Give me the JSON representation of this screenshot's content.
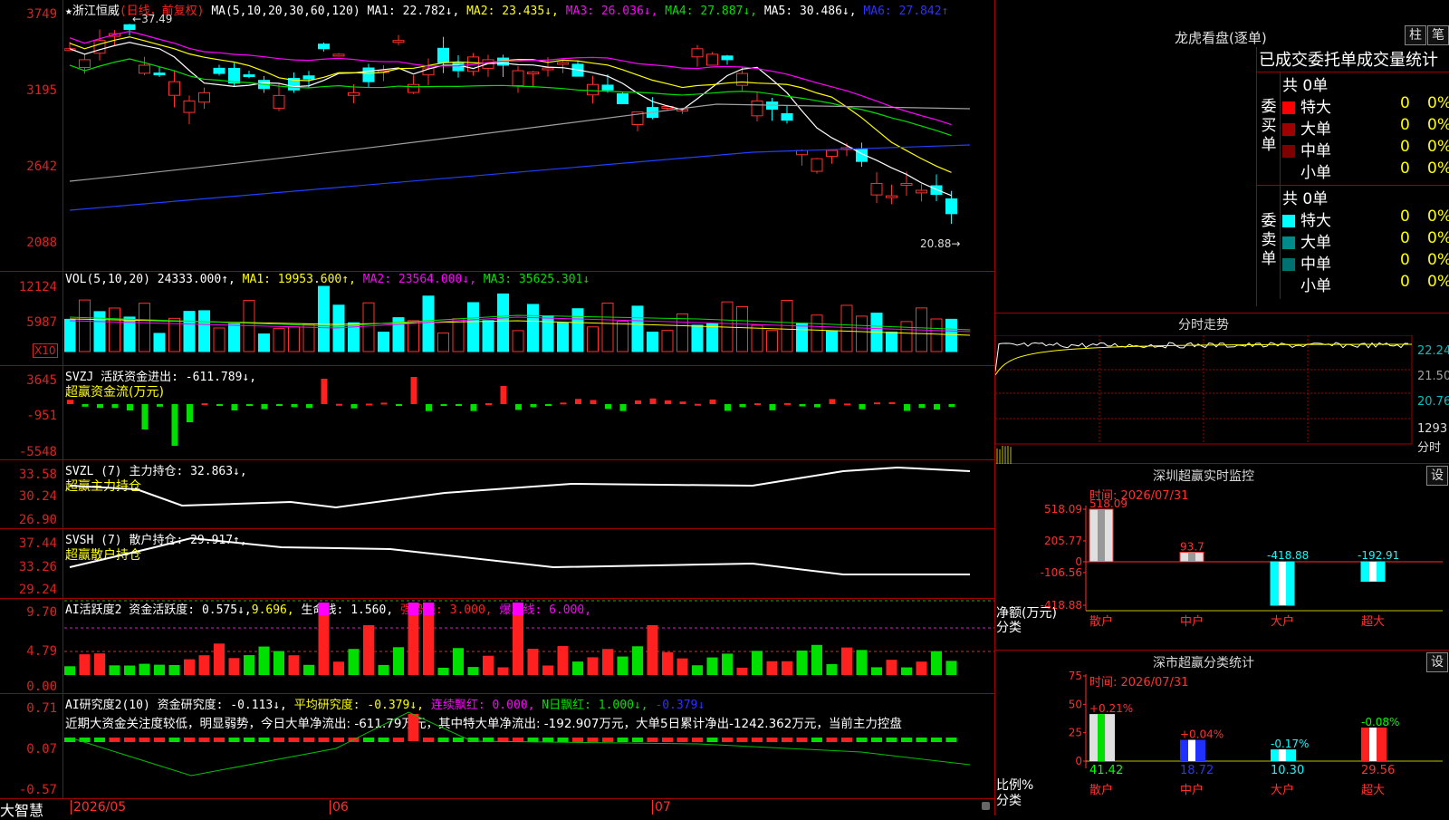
{
  "header": {
    "stock_name": "浙江恒威",
    "star": "★",
    "period": "(日线，前复权)",
    "ma_label": "MA(5,10,20,30,60,120)",
    "ma1": "MA1: 22.782↓,",
    "ma2": "MA2: 23.435↓,",
    "ma3": "MA3: 26.036↓,",
    "ma4": "MA4: 27.887↓,",
    "ma5": "MA5: 30.486↓,",
    "ma6": "MA6: 27.842↑",
    "max_label": "37.49",
    "min_label": "20.88",
    "price_ticks": [
      "3749",
      "3195",
      "2642",
      "2088"
    ]
  },
  "vol": {
    "label": "VOL(5,10,20)",
    "v": "24333.000↑,",
    "ma1": "MA1: 19953.600↑,",
    "ma2": "MA2: 23564.000↓,",
    "ma3": "MA3: 35625.301↓",
    "ticks": [
      "12124",
      "5987"
    ],
    "unit": "X10"
  },
  "svzj": {
    "label": "SVZJ  活跃资金进出: -611.789↓,",
    "sub": "超赢资金流(万元)",
    "ticks": [
      "3645",
      "-951",
      "-5548"
    ]
  },
  "svzl": {
    "label": "SVZL (7) 主力持仓: 32.863↓,",
    "sub": "超赢主力持仓",
    "ticks": [
      "33.58",
      "30.24",
      "26.90"
    ]
  },
  "svsh": {
    "label": "SVSH (7) 散户持仓: 29.917↑,",
    "sub": "超赢散户持仓",
    "ticks": [
      "37.44",
      "33.26",
      "29.24"
    ]
  },
  "ai1": {
    "a": "AI活跃度2 资金活跃度: 0.575↓,",
    "b": "9.696,",
    "c": "生命线: 1.560,",
    "d": "强势线: 3.000,",
    "e": "爆发线: 6.000,",
    "ticks": [
      "9.70",
      "4.79",
      "0.00"
    ]
  },
  "ai2": {
    "a": "AI研究度2(10) 资金研究度: -0.113↓,",
    "b": "平均研究度: -0.379↓,",
    "c": "连续飘红: 0.000,",
    "d": "N日飘红: 1.000↓,",
    "e": "-0.379↓",
    "note": "近期大资金关注度较低，明显弱势，今日大单净流出: -611.79万元，其中特大单净流出: -192.907万元，大单5日累计净出-1242.362万元，当前主力控盘",
    "ticks": [
      "0.71",
      "0.07",
      "-0.57"
    ]
  },
  "footer": {
    "brand": "大智慧",
    "dates": [
      "2026/05",
      "06",
      "07"
    ]
  },
  "lhb": {
    "title": "龙虎看盘(逐单)",
    "btn1": "柱",
    "btn2": "笔",
    "subtitle": "已成交委托单成交量统计",
    "buy_side": "委买单",
    "sell_side": "委卖单",
    "buy_total": "共 0单",
    "sell_total": "共 0单",
    "rows": [
      {
        "label": "特大",
        "count": "0",
        "pct": "0%"
      },
      {
        "label": "大单",
        "count": "0",
        "pct": "0%"
      },
      {
        "label": "中单",
        "count": "0",
        "pct": "0%"
      },
      {
        "label": "小单",
        "count": "0",
        "pct": "0%"
      }
    ],
    "buy_colors": [
      "#ff0000",
      "#a00000",
      "#800000",
      "#000000"
    ],
    "sell_colors": [
      "#00ffff",
      "#008b8b",
      "#007070",
      "#000000"
    ]
  },
  "intraday": {
    "title": "分时走势",
    "ticks": [
      "22.24",
      "21.50",
      "20.76"
    ],
    "vol_tick": "1293",
    "unit": "分时"
  },
  "monitor": {
    "title": "深圳超赢实时监控",
    "btn": "设",
    "time": "时间: 2026/07/31",
    "ylabel": "净额(万元)",
    "xlabel": "分类",
    "ticks": [
      "518.09",
      "205.77",
      "0",
      "-106.56",
      "-418.88"
    ],
    "bars": [
      {
        "name": "散户",
        "value": 518.09,
        "label": "518.09"
      },
      {
        "name": "中户",
        "value": 93.7,
        "label": "93.7"
      },
      {
        "name": "大户",
        "value": -418.88,
        "label": "-418.88"
      },
      {
        "name": "超大",
        "value": -192.91,
        "label": "-192.91"
      }
    ]
  },
  "classify": {
    "title": "深市超赢分类统计",
    "btn": "设",
    "time": "时间: 2026/07/31",
    "ylabel": "比例%",
    "xlabel": "分类",
    "ticks": [
      "75",
      "50",
      "25",
      "0"
    ],
    "bars": [
      {
        "name": "散户",
        "value": 41.42,
        "change": "+0.21%"
      },
      {
        "name": "中户",
        "value": 18.72,
        "change": "+0.04%"
      },
      {
        "name": "大户",
        "value": 10.3,
        "change": "-0.17%"
      },
      {
        "name": "超大",
        "value": 29.56,
        "change": "-0.08%"
      }
    ],
    "values_text": [
      "41.42",
      "18.72",
      "10.30",
      "29.56"
    ]
  },
  "chart_data": [
    {
      "type": "line",
      "name": "monitor",
      "categories": [
        "散户",
        "中户",
        "大户",
        "超大"
      ],
      "values": [
        518.09,
        93.7,
        -418.88,
        -192.91
      ]
    },
    {
      "type": "bar",
      "name": "classify",
      "categories": [
        "散户",
        "中户",
        "大户",
        "超大"
      ],
      "values": [
        41.42,
        18.72,
        10.3,
        29.56
      ]
    }
  ]
}
